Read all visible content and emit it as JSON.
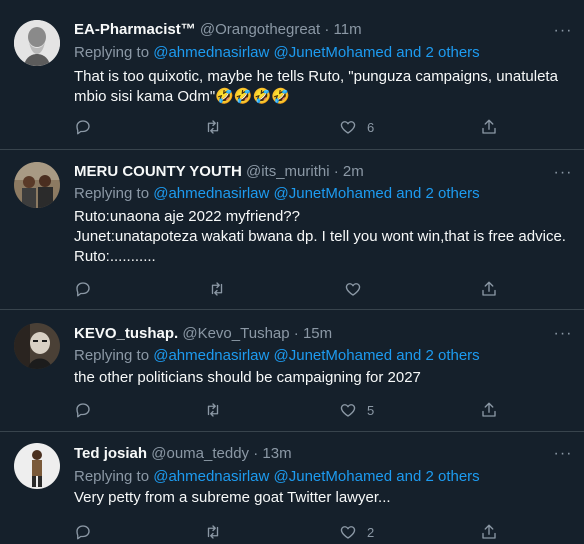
{
  "tweets": [
    {
      "name": "EA-Pharmacist™",
      "handle": "@Orangothegreat",
      "dot": "·",
      "time": "11m",
      "replying_prefix": "Replying to",
      "replying_to": "@ahmednasirlaw @JunetMohamed and 2 others",
      "text": "That is too quixotic, maybe he tells Ruto, \"punguza campaigns, unatuleta mbio sisi kama Odm\"🤣🤣🤣🤣",
      "likes": "6",
      "avatar": "bearded-man-sketch"
    },
    {
      "name": "MERU COUNTY YOUTH",
      "handle": "@its_murithi",
      "dot": "·",
      "time": "2m",
      "replying_prefix": "Replying to",
      "replying_to": "@ahmednasirlaw @JunetMohamed and 2 others",
      "text_lines": [
        "Ruto:unaona aje 2022 myfriend??",
        "Junet:unatapoteza wakati bwana dp. I tell you wont win,that is free advice.",
        "Ruto:..........."
      ],
      "likes": "",
      "avatar": "group-photo"
    },
    {
      "name": "KEVO_tushap.",
      "handle": "@Kevo_Tushap",
      "dot": "·",
      "time": "15m",
      "replying_prefix": "Replying to",
      "replying_to": "@ahmednasirlaw @JunetMohamed and 2 others",
      "text": "the other politicians should be campaigning for 2027",
      "likes": "5",
      "avatar": "masked-figure"
    },
    {
      "name": "Ted josiah",
      "handle": "@ouma_teddy",
      "dot": "·",
      "time": "13m",
      "replying_prefix": "Replying to",
      "replying_to": "@ahmednasirlaw @JunetMohamed and 2 others",
      "text": "Very petty from a subreme goat Twitter lawyer...",
      "likes": "2",
      "avatar": "standing-person"
    }
  ],
  "icons": {
    "reply": "reply-icon",
    "retweet": "retweet-icon",
    "like": "like-icon",
    "share": "share-icon",
    "more": "more-icon"
  },
  "colors": {
    "background": "#15202b",
    "link": "#1d9bf0",
    "muted": "#8b98a5",
    "divider": "#38444d"
  }
}
